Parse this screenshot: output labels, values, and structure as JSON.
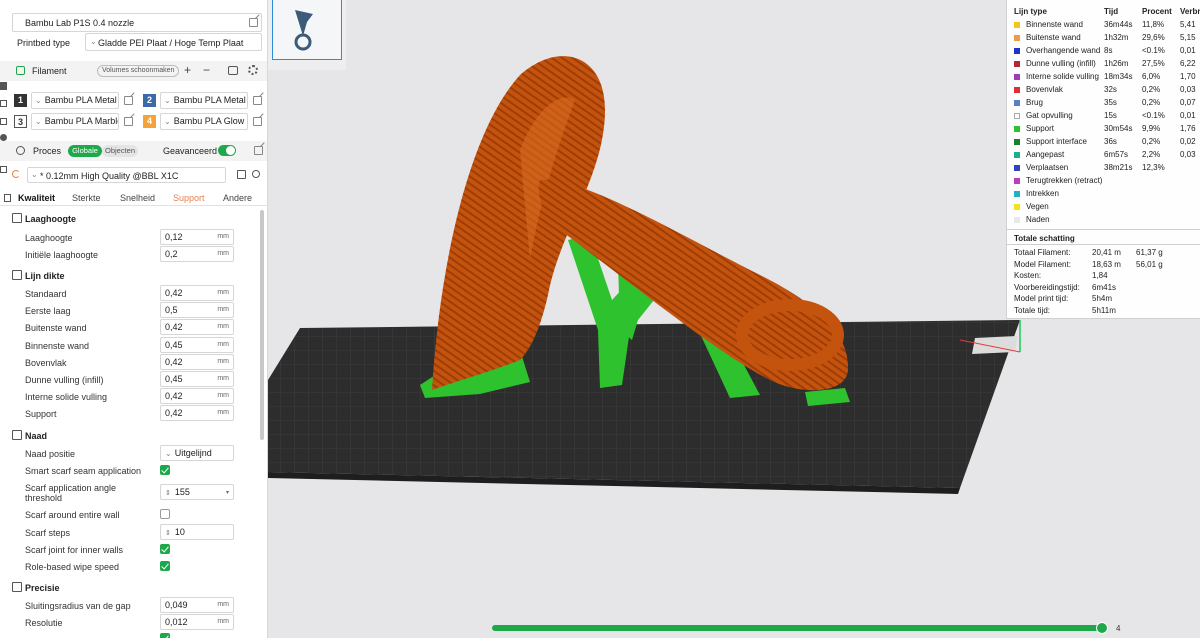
{
  "printer": {
    "label": "Bambu Lab P1S 0.4 nozzle"
  },
  "plate": {
    "label": "Printbed type",
    "value": "Gladde PEI Plaat / Hoge Temp Plaat"
  },
  "filament": {
    "label": "Filament",
    "clean_button": "Volumes schoonmaken",
    "slots": [
      {
        "num": "1",
        "name": "Bambu PLA Metal",
        "color": "#333333",
        "num_color": "#ffffff"
      },
      {
        "num": "2",
        "name": "Bambu PLA Metal",
        "color": "#3c69a8",
        "num_color": "#ffffff"
      },
      {
        "num": "3",
        "name": "Bambu PLA Marble",
        "color": "#ffffff",
        "num_color": "#333333"
      },
      {
        "num": "4",
        "name": "Bambu PLA Glow",
        "color": "#f3a33a",
        "num_color": "#ffffff"
      }
    ]
  },
  "process": {
    "label": "Proces",
    "toggle_global": "Globale",
    "toggle_objects": "Objecten",
    "advanced_label": "Geavanceerd",
    "preset": "* 0.12mm High Quality @BBL X1C"
  },
  "tabs": [
    "Kwaliteit",
    "Sterkte",
    "Snelheid",
    "Support",
    "Andere"
  ],
  "groups": {
    "laaghoogte": {
      "title": "Laaghoogte",
      "rows": [
        {
          "label": "Laaghoogte",
          "value": "0,12",
          "unit": "mm"
        },
        {
          "label": "Initiële laaghoogte",
          "value": "0,2",
          "unit": "mm"
        }
      ]
    },
    "lijndikte": {
      "title": "Lijn dikte",
      "rows": [
        {
          "label": "Standaard",
          "value": "0,42",
          "unit": "mm"
        },
        {
          "label": "Eerste laag",
          "value": "0,5",
          "unit": "mm"
        },
        {
          "label": "Buitenste wand",
          "value": "0,42",
          "unit": "mm"
        },
        {
          "label": "Binnenste wand",
          "value": "0,45",
          "unit": "mm"
        },
        {
          "label": "Bovenvlak",
          "value": "0,42",
          "unit": "mm"
        },
        {
          "label": "Dunne vulling (infill)",
          "value": "0,45",
          "unit": "mm"
        },
        {
          "label": "Interne solide vulling",
          "value": "0,42",
          "unit": "mm"
        },
        {
          "label": "Support",
          "value": "0,42",
          "unit": "mm"
        }
      ]
    },
    "naad": {
      "title": "Naad",
      "positie_label": "Naad positie",
      "positie_value": "Uitgelijnd",
      "smart_label": "Smart scarf seam application",
      "angle_label_1": "Scarf application angle",
      "angle_label_2": "threshold",
      "angle_value": "155",
      "around_label": "Scarf around entire wall",
      "steps_label": "Scarf steps",
      "steps_value": "10",
      "inner_label": "Scarf joint for inner walls",
      "wipe_label": "Role-based wipe speed"
    },
    "precisie": {
      "title": "Precisie",
      "rows": [
        {
          "label": "Sluitingsradius van de gap",
          "value": "0,049",
          "unit": "mm"
        },
        {
          "label": "Resolutie",
          "value": "0,012",
          "unit": "mm"
        }
      ]
    }
  },
  "legend": {
    "headers": {
      "type": "Lijn type",
      "time": "Tijd",
      "percent": "Procent",
      "filament": "Verbr"
    },
    "rows": [
      {
        "name": "Binnenste wand",
        "time": "36m44s",
        "percent": "11,8%",
        "fil": "5,41",
        "color": "#f5c518"
      },
      {
        "name": "Buitenste wand",
        "time": "1h32m",
        "percent": "29,6%",
        "fil": "5,15",
        "color": "#f29a4a"
      },
      {
        "name": "Overhangende wand",
        "time": "8s",
        "percent": "<0.1%",
        "fil": "0,01",
        "color": "#2233cc"
      },
      {
        "name": "Dunne vulling (infill)",
        "time": "1h26m",
        "percent": "27,5%",
        "fil": "6,22",
        "color": "#b0283a"
      },
      {
        "name": "Interne solide vulling",
        "time": "18m34s",
        "percent": "6,0%",
        "fil": "1,70",
        "color": "#9a3fb5"
      },
      {
        "name": "Bovenvlak",
        "time": "32s",
        "percent": "0,2%",
        "fil": "0,03",
        "color": "#d9303a"
      },
      {
        "name": "Brug",
        "time": "35s",
        "percent": "0,2%",
        "fil": "0,07",
        "color": "#5b7fc4"
      },
      {
        "name": "Gat opvulling",
        "time": "15s",
        "percent": "<0.1%",
        "fil": "0,01",
        "color": "#ffffff"
      },
      {
        "name": "Support",
        "time": "30m54s",
        "percent": "9,9%",
        "fil": "1,76",
        "color": "#2ec22e"
      },
      {
        "name": "Support interface",
        "time": "36s",
        "percent": "0,2%",
        "fil": "0,02",
        "color": "#1d7f2a"
      },
      {
        "name": "Aangepast",
        "time": "6m57s",
        "percent": "2,2%",
        "fil": "0,03",
        "color": "#1fae8a"
      },
      {
        "name": "Verplaatsen",
        "time": "38m21s",
        "percent": "12,3%",
        "fil": "",
        "color": "#3344bb"
      },
      {
        "name": "Terugtrekken (retract)",
        "time": "",
        "percent": "",
        "fil": "",
        "color": "#c03abf"
      },
      {
        "name": "Intrekken",
        "time": "",
        "percent": "",
        "fil": "",
        "color": "#27b0c4"
      },
      {
        "name": "Vegen",
        "time": "",
        "percent": "",
        "fil": "",
        "color": "#f3e21c"
      },
      {
        "name": "Naden",
        "time": "",
        "percent": "",
        "fil": "",
        "color": "#e8e8e8"
      }
    ],
    "totals_title": "Totale schatting",
    "totals": [
      {
        "label": "Totaal Filament:",
        "a": "20,41 m",
        "b": "61,37 g"
      },
      {
        "label": "Model Filament:",
        "a": "18,63 m",
        "b": "56,01 g"
      },
      {
        "label": "Kosten:",
        "a": "1,84",
        "b": ""
      },
      {
        "label": "Voorbereidingstijd:",
        "a": "6m41s",
        "b": ""
      },
      {
        "label": "Model print tijd:",
        "a": "5h4m",
        "b": ""
      },
      {
        "label": "Totale tijd:",
        "a": "5h11m",
        "b": ""
      }
    ]
  },
  "slider": {
    "value": "4"
  },
  "colors": {
    "accent": "#1fa84a",
    "model": "#c4530e",
    "support": "#2ec22e",
    "bed": "#2b2b2b"
  }
}
